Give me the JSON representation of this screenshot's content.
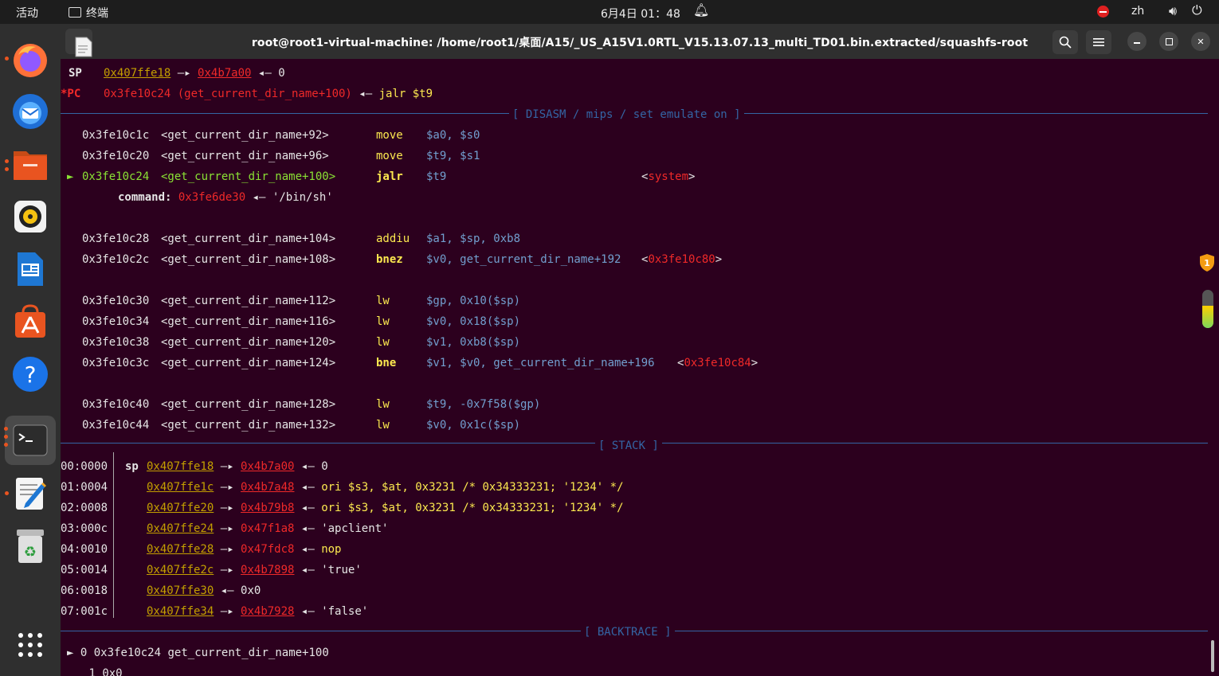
{
  "topbar": {
    "activities": "活动",
    "app_name": "终端",
    "clock": "6月4日 01：48",
    "lang": "zh"
  },
  "window": {
    "title": "root@root1-virtual-machine: /home/root1/桌面/A15/_US_A15V1.0RTL_V15.13.07.13_multi_TD01.bin.extracted/squashfs-root"
  },
  "registers": {
    "sp_label": "SP",
    "sp_addr": "0x407ffe18",
    "sp_arrow": "—▸",
    "sp_target": "0x4b7a00",
    "sp_left_arrow": "◂—",
    "sp_value": "0",
    "pc_label": "*PC",
    "pc_addr": "0x3fe10c24 (get_current_dir_name+100)",
    "pc_left_arrow": "◂—",
    "pc_instr": "jalr $t9"
  },
  "sections": {
    "disasm": "[ DISASM / mips / set emulate on ]",
    "stack": "[ STACK ]",
    "backtrace": "[ BACKTRACE ]"
  },
  "disasm": [
    {
      "marker": "",
      "addr": "0x3fe10c1c",
      "sym": "<get_current_dir_name+92>",
      "op": "move",
      "args": "$a0, $s0",
      "extra": ""
    },
    {
      "marker": "",
      "addr": "0x3fe10c20",
      "sym": "<get_current_dir_name+96>",
      "op": "move",
      "args": "$t9, $s1",
      "extra": ""
    },
    {
      "marker": "►",
      "addr": "0x3fe10c24",
      "sym": "<get_current_dir_name+100>",
      "op": "jalr",
      "args": "$t9",
      "extra": "<system>"
    },
    {
      "command_label": "command:",
      "command_addr": "0x3fe6de30",
      "command_arrow": "◂—",
      "command_value": "'/bin/sh'"
    },
    {
      "marker": "",
      "addr": "0x3fe10c28",
      "sym": "<get_current_dir_name+104>",
      "op": "addiu",
      "args": "$a1, $sp, 0xb8",
      "extra": ""
    },
    {
      "marker": "",
      "addr": "0x3fe10c2c",
      "sym": "<get_current_dir_name+108>",
      "op": "bnez",
      "args": "$v0, get_current_dir_name+192",
      "extra": "<0x3fe10c80>"
    },
    {
      "marker": "",
      "addr": "0x3fe10c30",
      "sym": "<get_current_dir_name+112>",
      "op": "lw",
      "args": "$gp, 0x10($sp)",
      "extra": ""
    },
    {
      "marker": "",
      "addr": "0x3fe10c34",
      "sym": "<get_current_dir_name+116>",
      "op": "lw",
      "args": "$v0, 0x18($sp)",
      "extra": ""
    },
    {
      "marker": "",
      "addr": "0x3fe10c38",
      "sym": "<get_current_dir_name+120>",
      "op": "lw",
      "args": "$v1, 0xb8($sp)",
      "extra": ""
    },
    {
      "marker": "",
      "addr": "0x3fe10c3c",
      "sym": "<get_current_dir_name+124>",
      "op": "bne",
      "args": "$v1, $v0, get_current_dir_name+196",
      "extra": "<0x3fe10c84>"
    },
    {
      "marker": "",
      "addr": "0x3fe10c40",
      "sym": "<get_current_dir_name+128>",
      "op": "lw",
      "args": "$t9, -0x7f58($gp)",
      "extra": ""
    },
    {
      "marker": "",
      "addr": "0x3fe10c44",
      "sym": "<get_current_dir_name+132>",
      "op": "lw",
      "args": "$v0, 0x1c($sp)",
      "extra": ""
    }
  ],
  "stack": [
    {
      "idx": "00:0000",
      "reg": "sp",
      "addr": "0x407ffe18",
      "arrow": "—▸",
      "target": "0x4b7a00",
      "arrow2": "◂—",
      "value": "0"
    },
    {
      "idx": "01:0004",
      "reg": "",
      "addr": "0x407ffe1c",
      "arrow": "—▸",
      "target": "0x4b7a48",
      "arrow2": "◂—",
      "value": "ori $s3, $at, 0x3231 /* 0x34333231; '1234' */"
    },
    {
      "idx": "02:0008",
      "reg": "",
      "addr": "0x407ffe20",
      "arrow": "—▸",
      "target": "0x4b79b8",
      "arrow2": "◂—",
      "value": "ori $s3, $at, 0x3231 /* 0x34333231; '1234' */"
    },
    {
      "idx": "03:000c",
      "reg": "",
      "addr": "0x407ffe24",
      "arrow": "—▸",
      "target": "0x47f1a8",
      "arrow2": "◂—",
      "value": "'apclient'"
    },
    {
      "idx": "04:0010",
      "reg": "",
      "addr": "0x407ffe28",
      "arrow": "—▸",
      "target": "0x47fdc8",
      "arrow2": "◂—",
      "value": "nop"
    },
    {
      "idx": "05:0014",
      "reg": "",
      "addr": "0x407ffe2c",
      "arrow": "—▸",
      "target": "0x4b7898",
      "arrow2": "◂—",
      "value": "'true'"
    },
    {
      "idx": "06:0018",
      "reg": "",
      "addr": "0x407ffe30",
      "arrow": "◂—",
      "target": "0x0",
      "arrow2": "",
      "value": ""
    },
    {
      "idx": "07:001c",
      "reg": "",
      "addr": "0x407ffe34",
      "arrow": "—▸",
      "target": "0x4b7928",
      "arrow2": "◂—",
      "value": "'false'"
    }
  ],
  "backtrace": [
    {
      "marker": "►",
      "num": "0",
      "addr": "0x3fe10c24",
      "sym": "get_current_dir_name+100"
    },
    {
      "marker": "",
      "num": "1",
      "addr": "0x0",
      "sym": ""
    }
  ],
  "colors": {
    "terminal_bg": "#2c001e",
    "section_line": "#3465a4",
    "address_yellow": "#c4a000",
    "address_red": "#ef2929",
    "opcode_yellow": "#fce94f",
    "register_blue": "#729fcf",
    "current_green": "#8ae234",
    "dock_active": "#e95420"
  },
  "icons": {
    "dock": [
      "firefox-icon",
      "thunderbird-icon",
      "files-icon",
      "rhythmbox-icon",
      "writer-icon",
      "app-center-icon",
      "help-icon",
      "terminal-icon",
      "text-editor-icon",
      "trash-icon",
      "show-apps-icon"
    ]
  }
}
